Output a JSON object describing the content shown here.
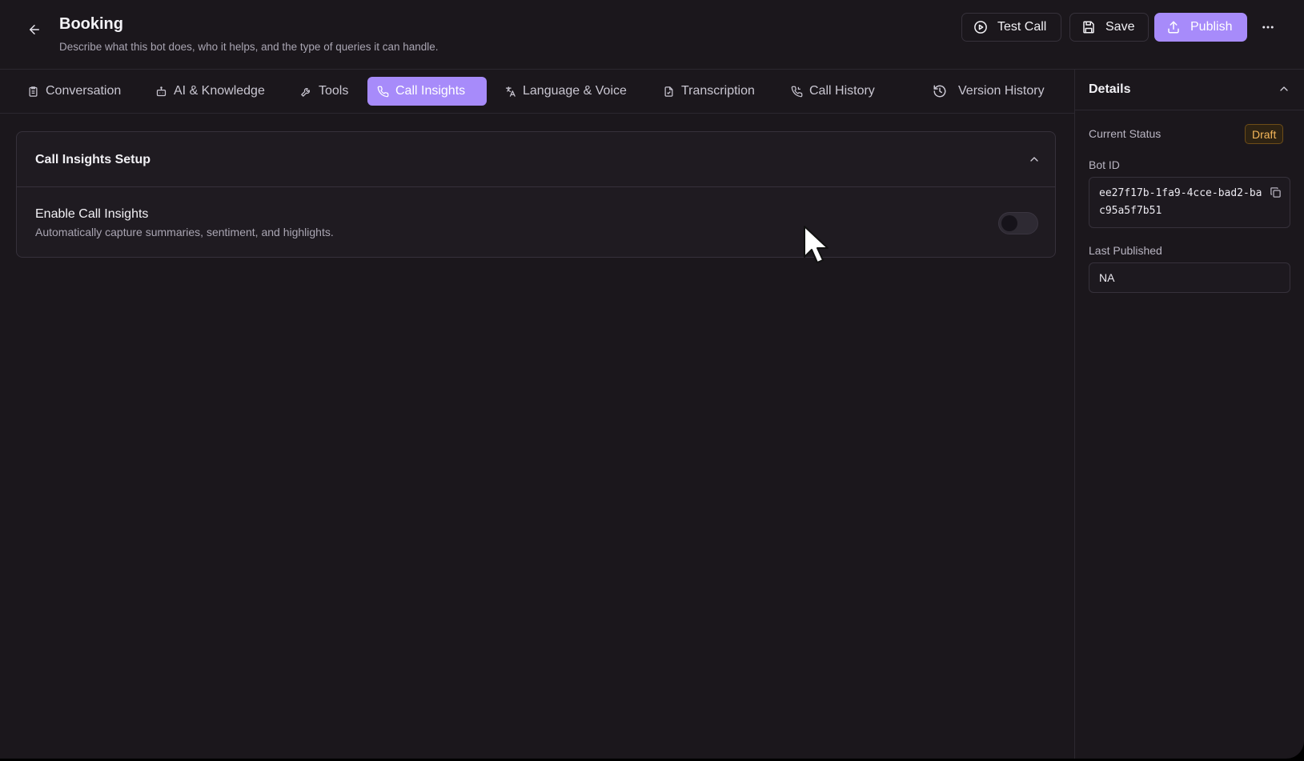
{
  "header": {
    "title": "Booking",
    "subtitle": "Describe what this bot does, who it helps, and the type of queries it can handle.",
    "test_call_label": "Test Call",
    "save_label": "Save",
    "publish_label": "Publish"
  },
  "tabs": [
    {
      "label": "Conversation",
      "icon": "clipboard-icon"
    },
    {
      "label": "AI & Knowledge",
      "icon": "bot-icon"
    },
    {
      "label": "Tools",
      "icon": "wrench-icon"
    },
    {
      "label": "Call Insights",
      "icon": "phone-icon",
      "active": true
    },
    {
      "label": "Language & Voice",
      "icon": "translate-icon"
    },
    {
      "label": "Transcription",
      "icon": "file-icon"
    },
    {
      "label": "Call History",
      "icon": "phone-history-icon"
    },
    {
      "label": "Version History",
      "icon": "history-icon"
    }
  ],
  "main": {
    "card_title": "Call Insights Setup",
    "enable_title": "Enable Call Insights",
    "enable_description": "Automatically capture summaries, sentiment, and highlights.",
    "enabled": false
  },
  "details": {
    "title": "Details",
    "current_status_label": "Current Status",
    "status": "Draft",
    "bot_id_label": "Bot ID",
    "bot_id": "ee27f17b-1fa9-4cce-bad2-bac95a5f7b51",
    "last_published_label": "Last Published",
    "last_published": "NA"
  },
  "colors": {
    "background": "#1b171c",
    "accent": "#a78bfa",
    "draft_badge": "#f4b65a",
    "border": "#36313b"
  }
}
